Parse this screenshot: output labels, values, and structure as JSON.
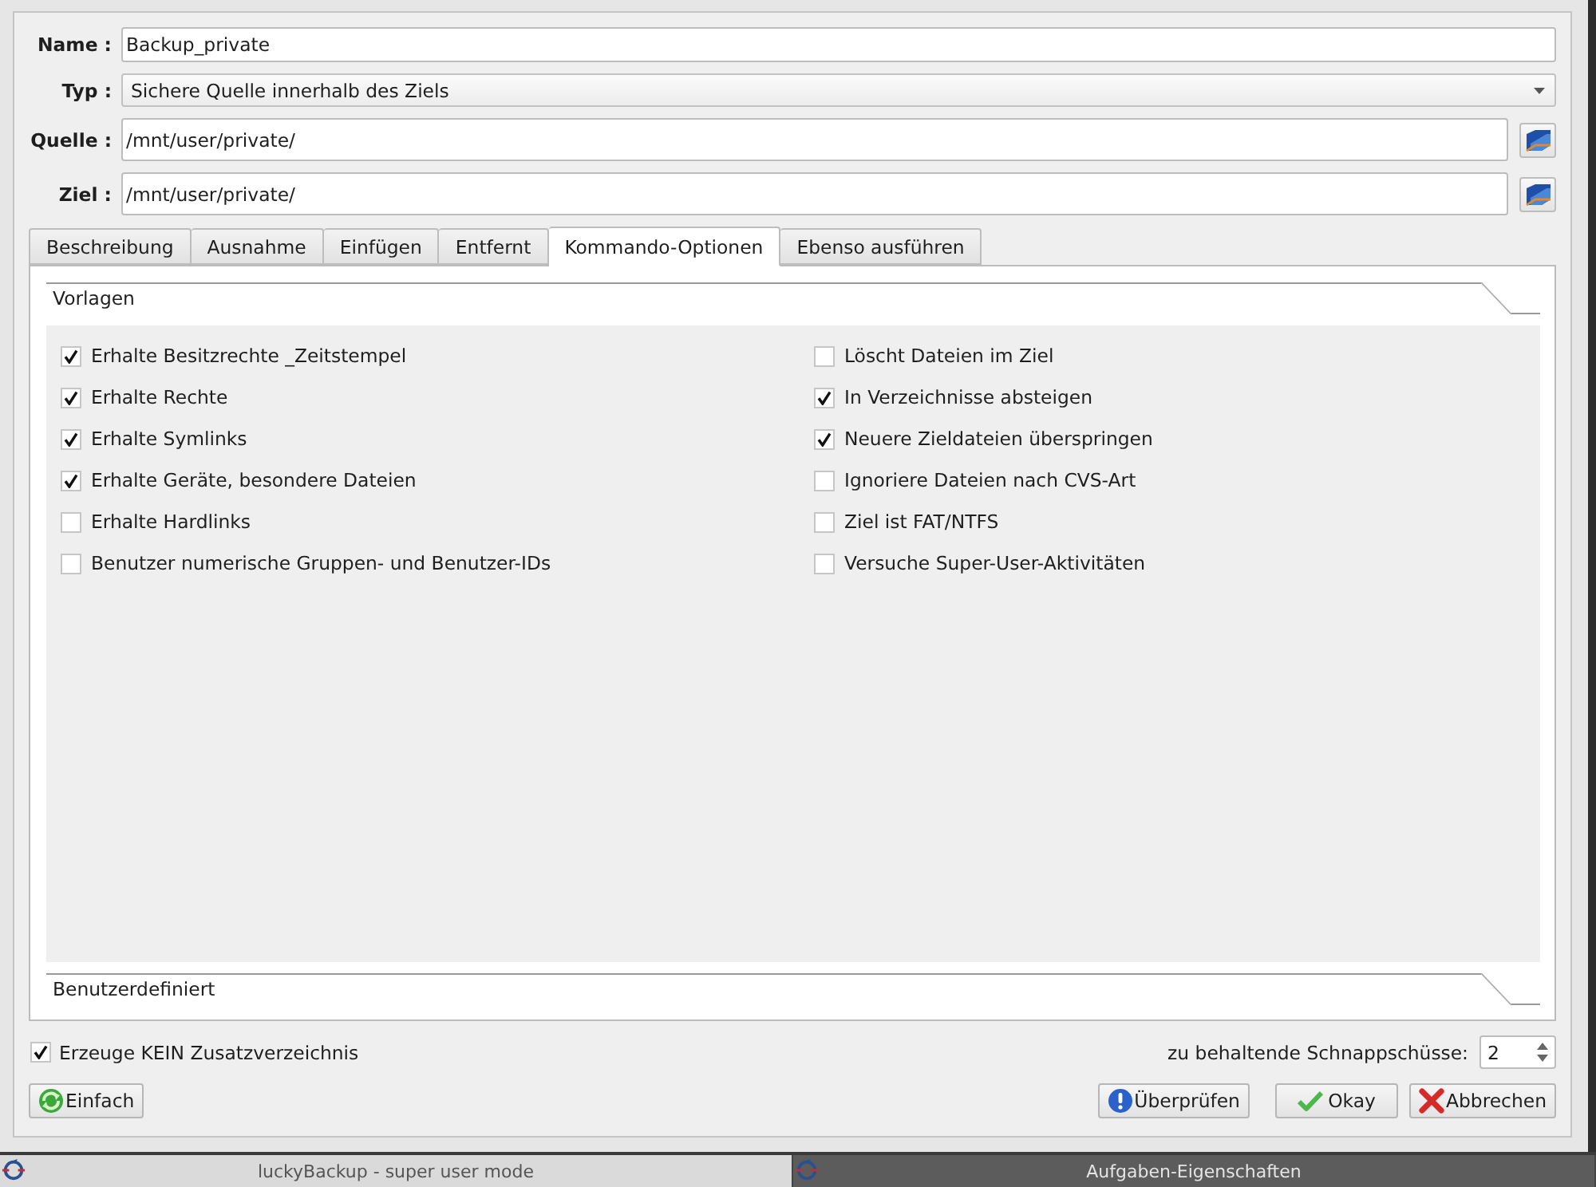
{
  "form": {
    "fields": [
      {
        "label": "Name :",
        "kind": "text",
        "value": "Backup_private"
      },
      {
        "label": "Typ :",
        "kind": "combo",
        "value": "Sichere Quelle innerhalb des Ziels"
      },
      {
        "label": "Quelle :",
        "kind": "path",
        "value": "/mnt/user/private/"
      },
      {
        "label": "Ziel :",
        "kind": "path",
        "value": "/mnt/user/private/"
      }
    ]
  },
  "tabs": [
    {
      "label": "Beschreibung",
      "selected": false
    },
    {
      "label": "Ausnahme",
      "selected": false
    },
    {
      "label": "Einfügen",
      "selected": false
    },
    {
      "label": "Entfernt",
      "selected": false
    },
    {
      "label": "Kommando-Optionen",
      "selected": true
    },
    {
      "label": "Ebenso ausführen",
      "selected": false
    }
  ],
  "sections": [
    {
      "title": "Vorlagen",
      "columns": [
        {
          "options": [
            {
              "label": "Erhalte Besitzrechte _Zeitstempel",
              "checked": true
            },
            {
              "label": "Erhalte Rechte",
              "checked": true
            },
            {
              "label": "Erhalte Symlinks",
              "checked": true
            },
            {
              "label": "Erhalte Geräte, besondere Dateien",
              "checked": true
            },
            {
              "label": "Erhalte Hardlinks",
              "checked": false
            },
            {
              "label": "Benutzer numerische Gruppen- und Benutzer-IDs",
              "checked": false
            }
          ]
        },
        {
          "options": [
            {
              "label": "Löscht Dateien im Ziel",
              "checked": false
            },
            {
              "label": "In Verzeichnisse absteigen",
              "checked": true
            },
            {
              "label": "Neuere Zieldateien überspringen",
              "checked": true
            },
            {
              "label": "Ignoriere Dateien nach CVS-Art",
              "checked": false
            },
            {
              "label": "Ziel ist FAT/NTFS",
              "checked": false
            },
            {
              "label": "Versuche Super-User-Aktivitäten",
              "checked": false
            }
          ]
        }
      ]
    },
    {
      "title": "Benutzerdefiniert"
    }
  ],
  "no_extra_dir": {
    "label": "Erzeuge KEIN Zusatzverzeichnis",
    "checked": true
  },
  "snapshots": {
    "label": "zu behaltende Schnappschüsse:",
    "value": "2"
  },
  "buttons": [
    {
      "label": "Einfach",
      "kind": "mode"
    },
    {
      "label": "Überprüfen",
      "kind": "validate"
    },
    {
      "label": "Okay",
      "kind": "ok"
    },
    {
      "label": "Abbrechen",
      "kind": "cancel"
    }
  ],
  "taskbar": [
    {
      "label": "luckyBackup - super user mode",
      "selected": false
    },
    {
      "label": "Aufgaben-Eigenschaften",
      "selected": true
    }
  ]
}
